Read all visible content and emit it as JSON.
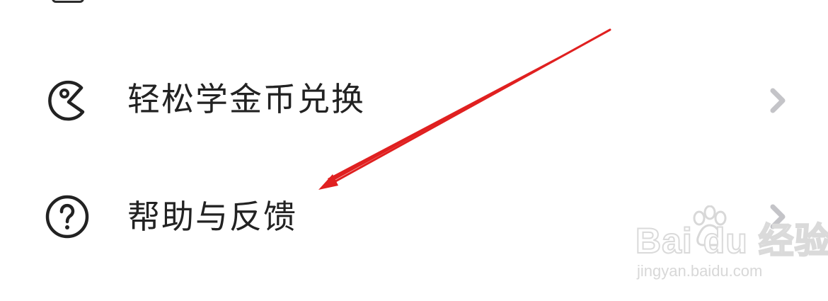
{
  "menu": {
    "items": [
      {
        "label": "轻松学金币兑换",
        "icon": "pacman-icon",
        "chevron": "chevron-right-icon"
      },
      {
        "label": "帮助与反馈",
        "icon": "help-circle-icon",
        "chevron": "chevron-right-icon"
      }
    ]
  },
  "annotation": {
    "arrow_color": "#e02020",
    "points_to": "帮助与反馈"
  },
  "watermark": {
    "logo_text": "Bai du 经验",
    "url": "jingyan.baidu.com",
    "icon": "paw-icon"
  },
  "colors": {
    "text": "#222222",
    "icon_stroke": "#222222",
    "chevron": "#c4c4c8",
    "background": "#ffffff"
  }
}
